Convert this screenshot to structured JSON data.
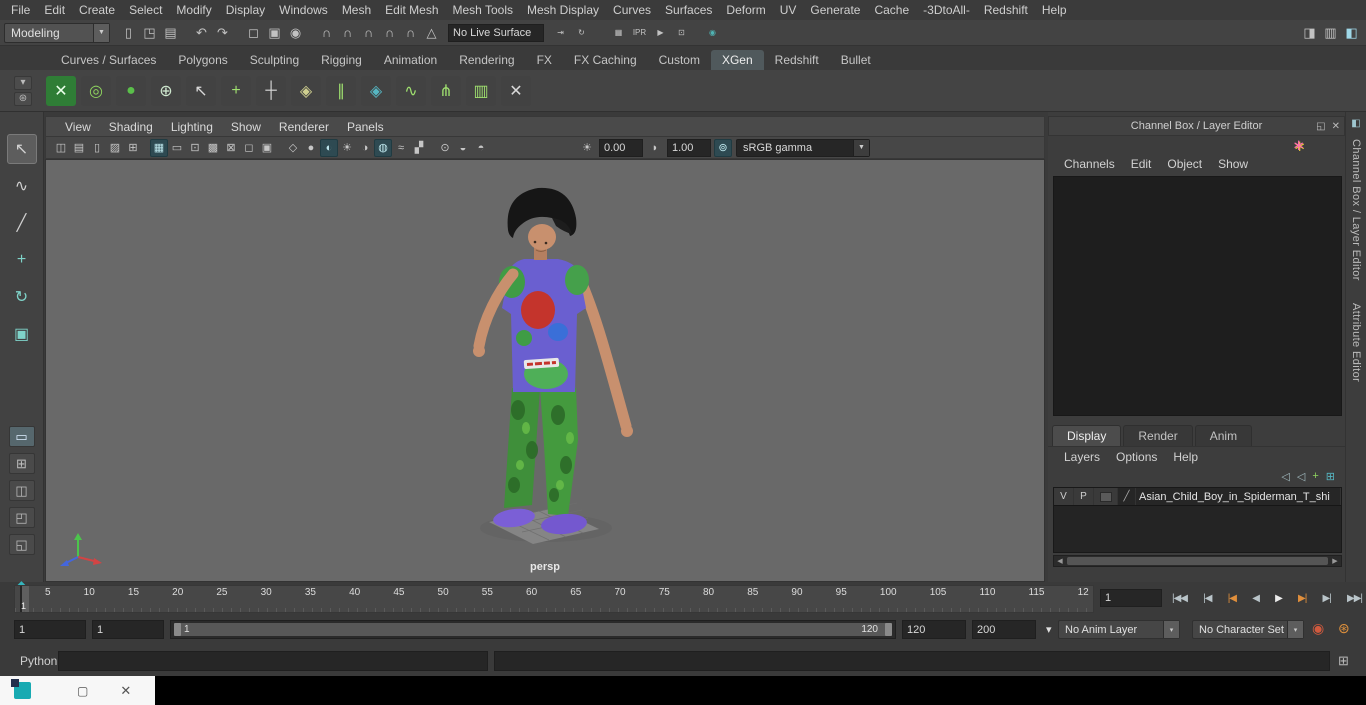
{
  "ui": {
    "dropdown_arrow": "▼",
    "small_arrow": "▾",
    "scroll_left": "◀",
    "scroll_right": "▶",
    "float_icon": "◱",
    "close_icon": "✕",
    "sparkle_icon": "∗",
    "dock_icon": "◧",
    "command_icon": "⊞",
    "autokey_icon": "◉",
    "prefs_icon": "⊛",
    "exposure_icon": "☀",
    "gamma_icon": "◗",
    "colormgmt_icon": "⊚",
    "shelf_menu_icon": "▾",
    "shelf_gear_icon": "⊛",
    "diagonal_icon": "╱",
    "restore_icon": "▢",
    "taskbar_close_icon": "✕"
  },
  "menubar": {
    "items": [
      "File",
      "Edit",
      "Create",
      "Select",
      "Modify",
      "Display",
      "Windows",
      "Mesh",
      "Edit Mesh",
      "Mesh Tools",
      "Mesh Display",
      "Curves",
      "Surfaces",
      "Deform",
      "UV",
      "Generate",
      "Cache",
      "-3DtoAll-",
      "Redshift",
      "Help"
    ]
  },
  "statusline": {
    "menuset": "Modeling",
    "live_surface": "No Live Surface",
    "icons_left": [
      {
        "name": "new-scene-icon",
        "glyph": "▯"
      },
      {
        "name": "open-scene-icon",
        "glyph": "◳"
      },
      {
        "name": "save-scene-icon",
        "glyph": "▤"
      },
      {
        "name": "undo-icon",
        "glyph": "↶",
        "gap": 10
      },
      {
        "name": "redo-icon",
        "glyph": "↷"
      },
      {
        "name": "select-hierarchy-icon",
        "glyph": "◻",
        "gap": 10
      },
      {
        "name": "select-object-icon",
        "glyph": "▣"
      },
      {
        "name": "select-component-icon",
        "glyph": "◉"
      },
      {
        "name": "snap-grid-icon",
        "glyph": "∩",
        "gap": 10
      },
      {
        "name": "snap-curve-icon",
        "glyph": "∩"
      },
      {
        "name": "snap-point-icon",
        "glyph": "∩"
      },
      {
        "name": "snap-projected-center-icon",
        "glyph": "∩"
      },
      {
        "name": "snap-view-plane-icon",
        "glyph": "∩"
      },
      {
        "name": "make-live-icon",
        "glyph": "△"
      }
    ],
    "icons_mid": [
      {
        "name": "input-connections-icon",
        "glyph": "⇥"
      },
      {
        "name": "construction-history-icon",
        "glyph": "↻"
      },
      {
        "name": "render-icon",
        "glyph": "▦",
        "gap": 16
      },
      {
        "name": "ipr-render-icon",
        "glyph": "IPR"
      },
      {
        "name": "render-sequence-icon",
        "glyph": "▶"
      },
      {
        "name": "render-settings-icon",
        "glyph": "⊡"
      },
      {
        "name": "paint-effects-icon",
        "glyph": "◉",
        "color": "#4fb3b3",
        "gap": 10
      }
    ],
    "icons_right": [
      {
        "name": "sidebar-attribute-editor-icon",
        "glyph": "◨"
      },
      {
        "name": "sidebar-tool-settings-icon",
        "glyph": "▥"
      },
      {
        "name": "sidebar-channel-box-icon",
        "glyph": "◧",
        "color": "#9fd8e8"
      }
    ]
  },
  "shelf": {
    "tabs": [
      "Curves / Surfaces",
      "Polygons",
      "Sculpting",
      "Rigging",
      "Animation",
      "Rendering",
      "FX",
      "FX Caching",
      "Custom",
      "XGen",
      "Redshift",
      "Bullet"
    ],
    "active_tab": "XGen",
    "icons": [
      {
        "name": "xgen-editor-icon",
        "glyph": "✕",
        "color": "#eaffea",
        "bg": "#2f7d36"
      },
      {
        "name": "xgen-preview-icon",
        "glyph": "◎",
        "color": "#8fd45f"
      },
      {
        "name": "xgen-density-brush-icon",
        "glyph": "●",
        "color": "#5abf4a"
      },
      {
        "name": "xgen-create-sphere-icon",
        "glyph": "⊕",
        "color": "#cfe8cf"
      },
      {
        "name": "xgen-select-icon",
        "glyph": "↖",
        "color": "#d8d8d8"
      },
      {
        "name": "xgen-add-icon",
        "glyph": "+",
        "color": "#9fe06f"
      },
      {
        "name": "xgen-ground-icon",
        "glyph": "┼",
        "color": "#d8d8d8"
      },
      {
        "name": "xgen-lock-icon",
        "glyph": "◈",
        "color": "#cfcf8f"
      },
      {
        "name": "xgen-guides-icon",
        "glyph": "∥",
        "color": "#9fe06f"
      },
      {
        "name": "xgen-grid-icon",
        "glyph": "◈",
        "color": "#56b6c2"
      },
      {
        "name": "xgen-curve-icon",
        "glyph": "∿",
        "color": "#9fe06f"
      },
      {
        "name": "xgen-strands-icon",
        "glyph": "⋔",
        "color": "#9fe06f"
      },
      {
        "name": "xgen-fence-icon",
        "glyph": "▥",
        "color": "#9fe06f"
      },
      {
        "name": "xgen-scissors-icon",
        "glyph": "✕",
        "color": "#d8d8d8"
      }
    ]
  },
  "toolbox": {
    "tools": [
      {
        "name": "select-tool-icon",
        "glyph": "↖",
        "active": true
      },
      {
        "name": "lasso-tool-icon",
        "glyph": "∿"
      },
      {
        "name": "paint-select-tool-icon",
        "glyph": "╱"
      },
      {
        "name": "move-tool-icon",
        "glyph": "+",
        "color": "#7fd3c9"
      },
      {
        "name": "rotate-tool-icon",
        "glyph": "↻",
        "color": "#7fd3c9"
      },
      {
        "name": "scale-tool-icon",
        "glyph": "▣",
        "color": "#7fd3c9"
      }
    ],
    "layouts": [
      {
        "name": "layout-single-pane-icon",
        "glyph": "▭",
        "active": true
      },
      {
        "name": "layout-four-pane-icon",
        "glyph": "⊞"
      },
      {
        "name": "layout-two-pane-icon",
        "glyph": "◫"
      },
      {
        "name": "layout-persp-outliner-icon",
        "glyph": "◰"
      },
      {
        "name": "layout-custom-icon",
        "glyph": "◱"
      }
    ],
    "maya_toggle_glyph": "◆"
  },
  "viewport": {
    "menus": [
      "View",
      "Shading",
      "Lighting",
      "Show",
      "Renderer",
      "Panels"
    ],
    "toolbar_icons": [
      {
        "name": "look-through-selected-icon",
        "glyph": "◫"
      },
      {
        "name": "camera-attributes-icon",
        "glyph": "▤"
      },
      {
        "name": "bookmark-icon",
        "glyph": "▯"
      },
      {
        "name": "image-plane-icon",
        "glyph": "▨"
      },
      {
        "name": "pan-zoom-icon",
        "glyph": "⊞"
      },
      {
        "name": "grid-display-icon",
        "glyph": "▦",
        "active": true,
        "gap": 8
      },
      {
        "name": "film-gate-icon",
        "glyph": "▭"
      },
      {
        "name": "resolution-gate-icon",
        "glyph": "⊡"
      },
      {
        "name": "gate-mask-icon",
        "glyph": "▩"
      },
      {
        "name": "field-chart-icon",
        "glyph": "⊠"
      },
      {
        "name": "safe-action-icon",
        "glyph": "◻"
      },
      {
        "name": "safe-title-icon",
        "glyph": "▣"
      },
      {
        "name": "wireframe-icon",
        "glyph": "◇",
        "gap": 8
      },
      {
        "name": "shaded-icon",
        "glyph": "●"
      },
      {
        "name": "textured-icon",
        "glyph": "◐",
        "active": true
      },
      {
        "name": "use-all-lights-icon",
        "glyph": "☀"
      },
      {
        "name": "shadows-icon",
        "glyph": "◑"
      },
      {
        "name": "ambient-occlusion-icon",
        "glyph": "◍",
        "active": true
      },
      {
        "name": "motion-blur-icon",
        "glyph": "≈"
      },
      {
        "name": "anti-alias-icon",
        "glyph": "▞"
      },
      {
        "name": "isolate-select-icon",
        "glyph": "⊙",
        "gap": 8
      },
      {
        "name": "xray-icon",
        "glyph": "◒"
      },
      {
        "name": "joint-xray-icon",
        "glyph": "◓"
      }
    ],
    "exposure": "0.00",
    "gamma": "1.00",
    "color_mode": "sRGB gamma",
    "camera_label": "persp"
  },
  "channel_box": {
    "title": "Channel Box / Layer Editor",
    "menus": [
      "Channels",
      "Edit",
      "Object",
      "Show"
    ],
    "tabs": [
      "Display",
      "Render",
      "Anim"
    ],
    "active_tab": "Display",
    "layer_menus": [
      "Layers",
      "Options",
      "Help"
    ],
    "layer_toolbar_icons": [
      {
        "name": "move-layer-up-icon",
        "glyph": "◁"
      },
      {
        "name": "move-layer-down-icon",
        "glyph": "◁"
      },
      {
        "name": "new-empty-layer-icon",
        "glyph": "+",
        "color": "#8fd45f"
      },
      {
        "name": "new-layer-from-selected-icon",
        "glyph": "⊞",
        "color": "#56b6c2"
      }
    ],
    "layer_row": {
      "visibility": "V",
      "playback": "P",
      "name": "Asian_Child_Boy_in_Spiderman_T_shi"
    }
  },
  "side_tabs": [
    "Channel Box / Layer Editor",
    "Attribute Editor"
  ],
  "timeline": {
    "ticks": [
      "5",
      "10",
      "15",
      "20",
      "25",
      "30",
      "35",
      "40",
      "45",
      "50",
      "55",
      "60",
      "65",
      "70",
      "75",
      "80",
      "85",
      "90",
      "95",
      "100",
      "105",
      "110",
      "115",
      "12"
    ],
    "current_frame": "1",
    "current_time_field": "1",
    "playback": [
      {
        "name": "go-to-start-button",
        "glyph": "|◀◀"
      },
      {
        "name": "step-back-frame-button",
        "glyph": "|◀"
      },
      {
        "name": "step-back-key-button",
        "glyph": "|◀",
        "color": "#e08f3c"
      },
      {
        "name": "play-backwards-button",
        "glyph": "◀"
      },
      {
        "name": "play-forwards-button",
        "glyph": "▶",
        "color": "#ececec"
      },
      {
        "name": "step-forward-key-button",
        "glyph": "▶|",
        "color": "#e08f3c"
      },
      {
        "name": "step-forward-frame-button",
        "glyph": "▶|"
      },
      {
        "name": "go-to-end-button",
        "glyph": "▶▶|"
      }
    ]
  },
  "range_slider": {
    "anim_start": "1",
    "playback_start": "1",
    "bar_start_label": "1",
    "bar_end_label": "120",
    "playback_end": "120",
    "anim_end": "200",
    "anim_layer": "No Anim Layer",
    "character_set": "No Character Set"
  },
  "command_line": {
    "label": "Python"
  }
}
